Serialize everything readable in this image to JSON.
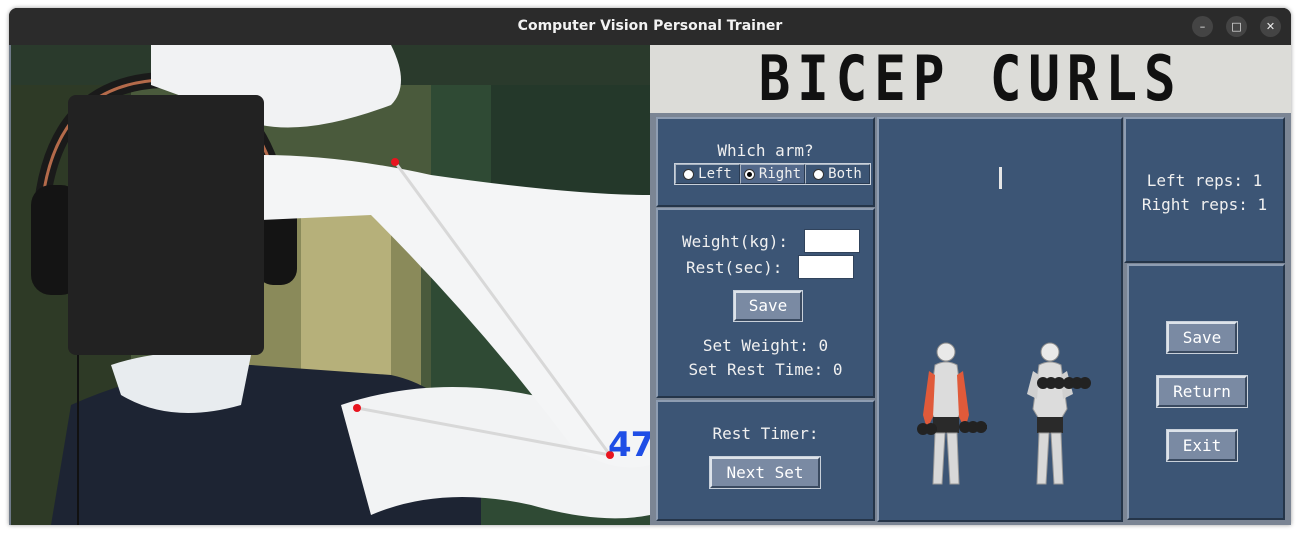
{
  "window": {
    "title": "Computer Vision Personal Trainer",
    "controls": [
      "–",
      "□",
      "✕"
    ]
  },
  "camera": {
    "angle_text": "47"
  },
  "header": {
    "title": "BICEP CURLS"
  },
  "arm_select": {
    "question": "Which arm?",
    "options": [
      "Left",
      "Right",
      "Both"
    ],
    "selected": "Right"
  },
  "settings": {
    "weight_label": "Weight(kg):",
    "rest_label": "Rest(sec):",
    "weight_value": "",
    "rest_value": "",
    "save_label": "Save",
    "set_weight_text": "Set Weight: 0",
    "set_rest_text": "Set Rest Time: 0"
  },
  "timer": {
    "label": "Rest Timer:",
    "next_set_label": "Next Set"
  },
  "reps": {
    "left_text": "Left reps: 1",
    "right_text": "Right reps: 1"
  },
  "actions": {
    "save_label": "Save",
    "return_label": "Return",
    "exit_label": "Exit"
  },
  "colors": {
    "panel": "#3c5575",
    "header_bg": "#dcdcd8",
    "angle": "#1f4ee6",
    "joint": "#e8141e"
  }
}
